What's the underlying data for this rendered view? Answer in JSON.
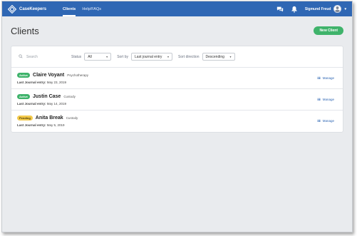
{
  "app": {
    "brand": "CaseKeepers"
  },
  "nav": {
    "items": [
      {
        "label": "Clients",
        "active": true
      },
      {
        "label": "Help/FAQs",
        "active": false
      }
    ]
  },
  "user": {
    "name": "Sigmund Freud"
  },
  "page": {
    "title": "Clients",
    "new_button": "New Client"
  },
  "filters": {
    "search_placeholder": "Search",
    "status_label": "Status",
    "status_value": "All",
    "sort_label": "Sort by",
    "sort_value": "Last journal entry",
    "direction_label": "Sort direction",
    "direction_value": "Descending"
  },
  "clients": [
    {
      "status": "Active",
      "name": "Claire Voyant",
      "type": "Psychotherapy",
      "meta_label": "Last Journal entry:",
      "date": "May 23, 2019",
      "manage": "Manage"
    },
    {
      "status": "Active",
      "name": "Justin Case",
      "type": "Custody",
      "meta_label": "Last Journal entry:",
      "date": "May 14, 2019",
      "manage": "Manage"
    },
    {
      "status": "Pending",
      "name": "Anita Break",
      "type": "Custody",
      "meta_label": "Last Journal entry:",
      "date": "May 5, 2019",
      "manage": "Manage"
    }
  ],
  "colors": {
    "topbar": "#2f67b4",
    "accent_green": "#3fb36b",
    "pending_yellow": "#f2c94c",
    "background": "#e9ebee"
  },
  "icons": {
    "logo": "casekeepers-logo-icon",
    "chat": "chat-icon",
    "bell": "bell-icon",
    "search": "search-icon",
    "manage": "list-icon"
  }
}
